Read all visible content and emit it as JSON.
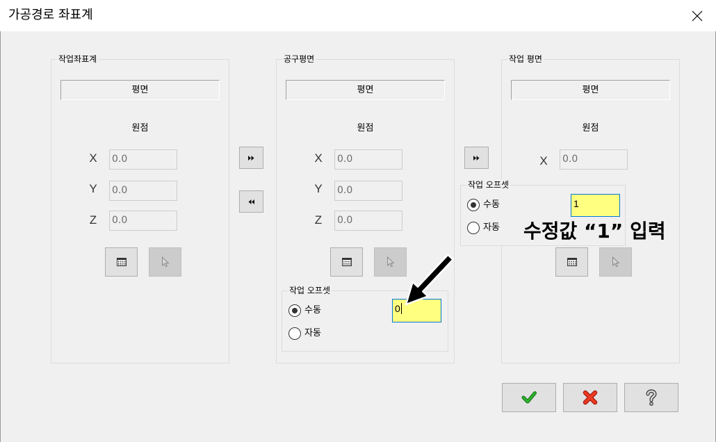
{
  "window": {
    "title": "가공경로 좌표계",
    "close_icon": "close-icon"
  },
  "panels": {
    "work_cs": {
      "label": "작업좌표계",
      "plane_label": "평면",
      "origin_label": "원점",
      "x": {
        "axis": "X",
        "value": "0.0"
      },
      "y": {
        "axis": "Y",
        "value": "0.0"
      },
      "z": {
        "axis": "Z",
        "value": "0.0"
      },
      "list_icon": "table-grid-icon",
      "pick_icon": "pointer-icon"
    },
    "tool_plane": {
      "label": "공구평면",
      "plane_label": "평면",
      "origin_label": "원점",
      "x": {
        "axis": "X",
        "value": "0.0"
      },
      "y": {
        "axis": "Y",
        "value": "0.0"
      },
      "z": {
        "axis": "Z",
        "value": "0.0"
      },
      "list_icon": "table-grid-icon",
      "pick_icon": "pointer-icon",
      "offset": {
        "label": "작업 오프셋",
        "manual_label": "수동",
        "auto_label": "자동",
        "manual_checked": true,
        "auto_checked": false,
        "value": "0"
      }
    },
    "work_plane": {
      "label": "작업 평면",
      "plane_label": "평면",
      "origin_label": "원점",
      "x": {
        "axis": "X",
        "value": "0.0"
      },
      "list_icon": "table-grid-icon",
      "pick_icon": "pointer-icon",
      "offset": {
        "label": "작업 오프셋",
        "manual_label": "수동",
        "auto_label": "자동",
        "manual_checked": true,
        "auto_checked": false,
        "value": "1"
      }
    }
  },
  "transfer": {
    "to_tool_plane_icon": "fast-forward-icon",
    "to_work_cs_icon": "rewind-icon",
    "to_work_plane_icon": "fast-forward-icon"
  },
  "annotation": {
    "text": "수정값 “1” 입력",
    "arrow_icon": "arrow-pointer-icon"
  },
  "footer": {
    "ok_icon": "checkmark-icon",
    "cancel_icon": "cancel-icon",
    "help_icon": "help-icon"
  },
  "colors": {
    "dialog_bg": "#f0f0f0",
    "title_bg": "#ffffff",
    "edit_highlight": "#ffff80",
    "focus_border": "#0078d7",
    "ok_green": "#2db52d",
    "cancel_red": "#ee3a22"
  }
}
